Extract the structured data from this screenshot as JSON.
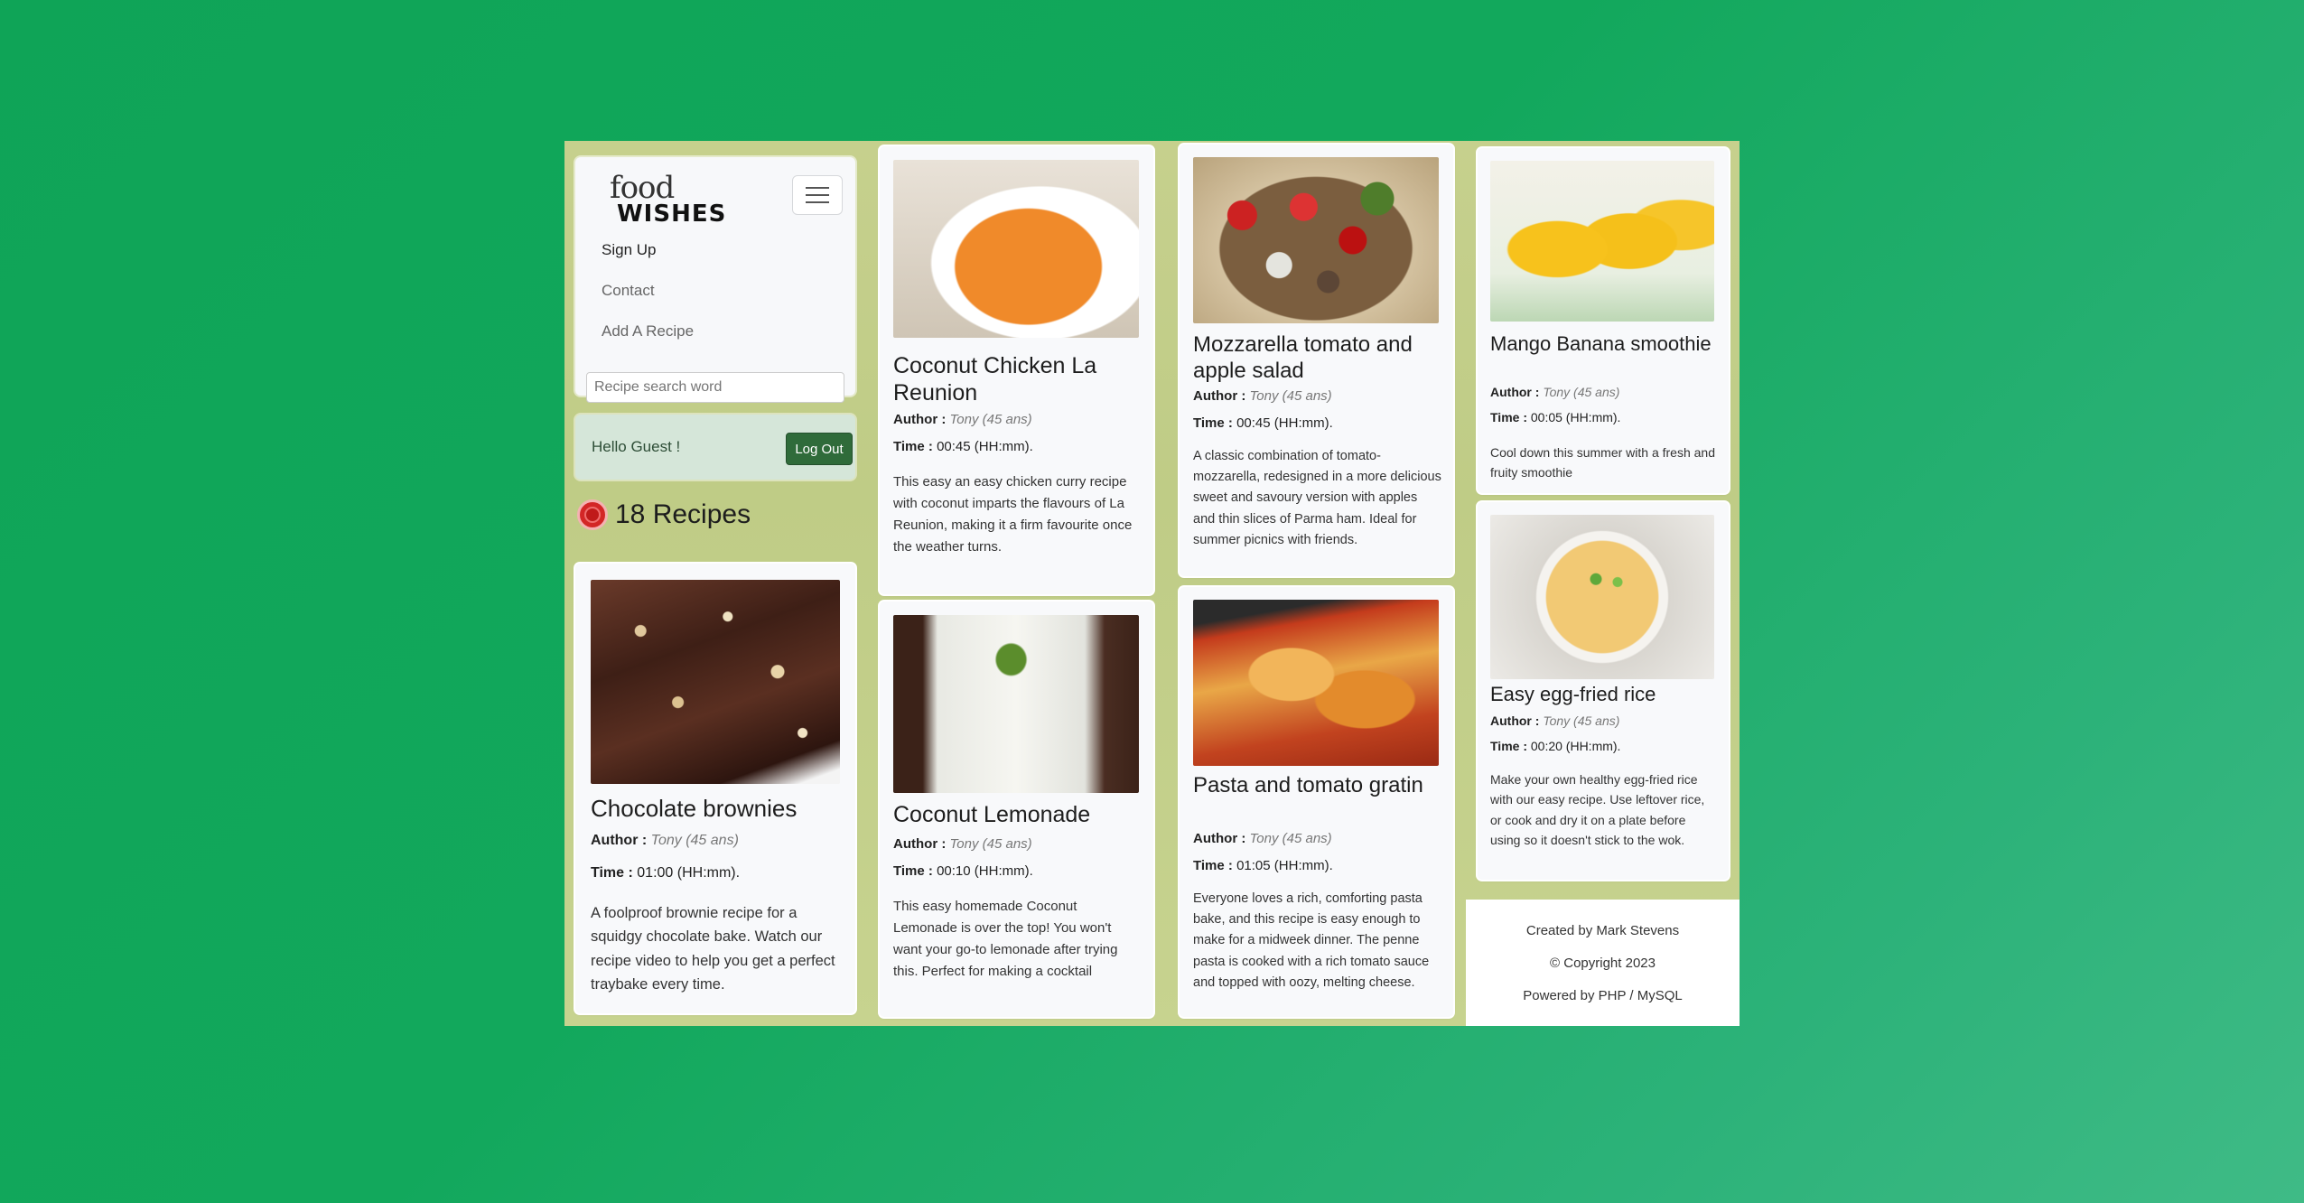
{
  "brand": {
    "line1": "food",
    "line2": "WISHES"
  },
  "nav": {
    "items": [
      {
        "label": "Sign Up"
      },
      {
        "label": "Contact"
      },
      {
        "label": "Add A Recipe"
      }
    ],
    "search_placeholder": "Recipe search word"
  },
  "greeting": {
    "text": "Hello Guest !",
    "logout_label": "Log Out"
  },
  "recipes_count": "18 Recipes",
  "labels": {
    "author": "Author :",
    "time": "Time :"
  },
  "recipes": [
    {
      "title": "Chocolate brownies",
      "author": "Tony (45 ans)",
      "time": "01:00 (HH:mm).",
      "description": "A foolproof brownie recipe for a squidgy chocolate bake. Watch our recipe video to help you get a perfect traybake every time."
    },
    {
      "title": "Coconut Chicken La Reunion",
      "author": "Tony (45 ans)",
      "time": "00:45 (HH:mm).",
      "description": "This easy an easy chicken curry recipe with coconut imparts the flavours of La Reunion, making it a firm favourite once the weather turns."
    },
    {
      "title": "Coconut Lemonade",
      "author": "Tony (45 ans)",
      "time": "00:10 (HH:mm).",
      "description": "This easy homemade Coconut Lemonade is over the top! You won't want your go-to lemonade after trying this. Perfect for making a cocktail"
    },
    {
      "title": "Mozzarella tomato and apple salad",
      "author": "Tony (45 ans)",
      "time": "00:45 (HH:mm).",
      "description": "A classic combination of tomato-mozzarella, redesigned in a more delicious sweet and savoury version with apples and thin slices of Parma ham. Ideal for summer picnics with friends."
    },
    {
      "title": "Pasta and tomato gratin",
      "author": "Tony (45 ans)",
      "time": "01:05 (HH:mm).",
      "description": "Everyone loves a rich, comforting pasta bake, and this recipe is easy enough to make for a midweek dinner. The penne pasta is cooked with a rich tomato sauce and topped with oozy, melting cheese."
    },
    {
      "title": "Mango Banana smoothie",
      "author": "Tony (45 ans)",
      "time": "00:05 (HH:mm).",
      "description": "Cool down this summer with a fresh and fruity smoothie"
    },
    {
      "title": "Easy egg-fried rice",
      "author": "Tony (45 ans)",
      "time": "00:20 (HH:mm).",
      "description": "Make your own healthy egg-fried rice with our easy recipe. Use leftover rice, or cook and dry it on a plate before using so it doesn't stick to the wok."
    }
  ],
  "footer": {
    "created_by": "Created by Mark Stevens",
    "copyright": "© Copyright 2023",
    "powered_by": "Powered by PHP / MySQL"
  }
}
